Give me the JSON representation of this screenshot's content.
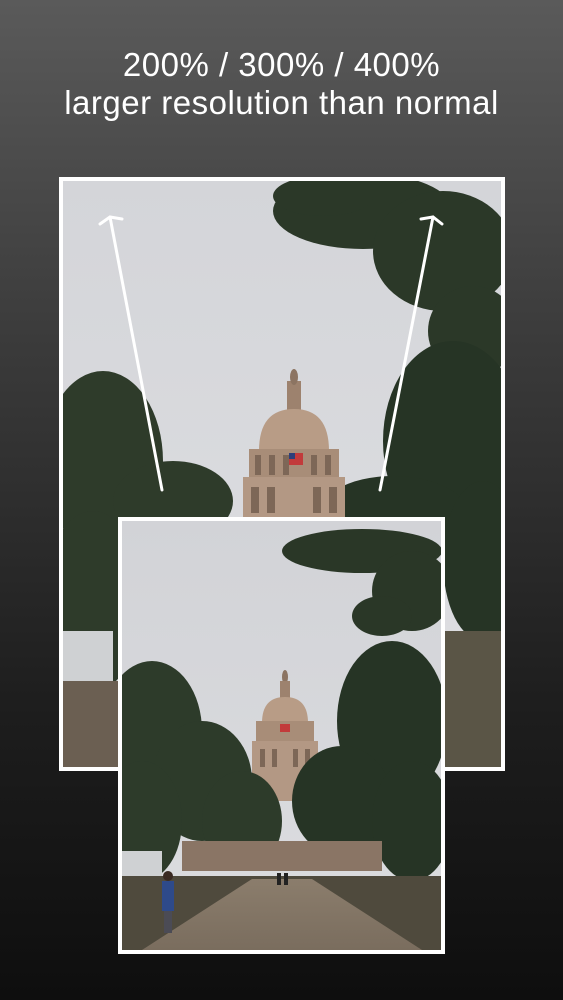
{
  "headline": {
    "line1": "200% / 300% / 400%",
    "line2": "larger resolution than normal"
  },
  "photos": {
    "large": {
      "subject": "capitol-building-enlarged"
    },
    "small": {
      "subject": "capitol-building-original"
    }
  },
  "colors": {
    "frame": "#ffffff",
    "sky": "#d8d9dc",
    "dome": "#b89c86",
    "foliage": "#2c3a28"
  },
  "icons": [
    "expand-arrow-left",
    "expand-arrow-right"
  ]
}
